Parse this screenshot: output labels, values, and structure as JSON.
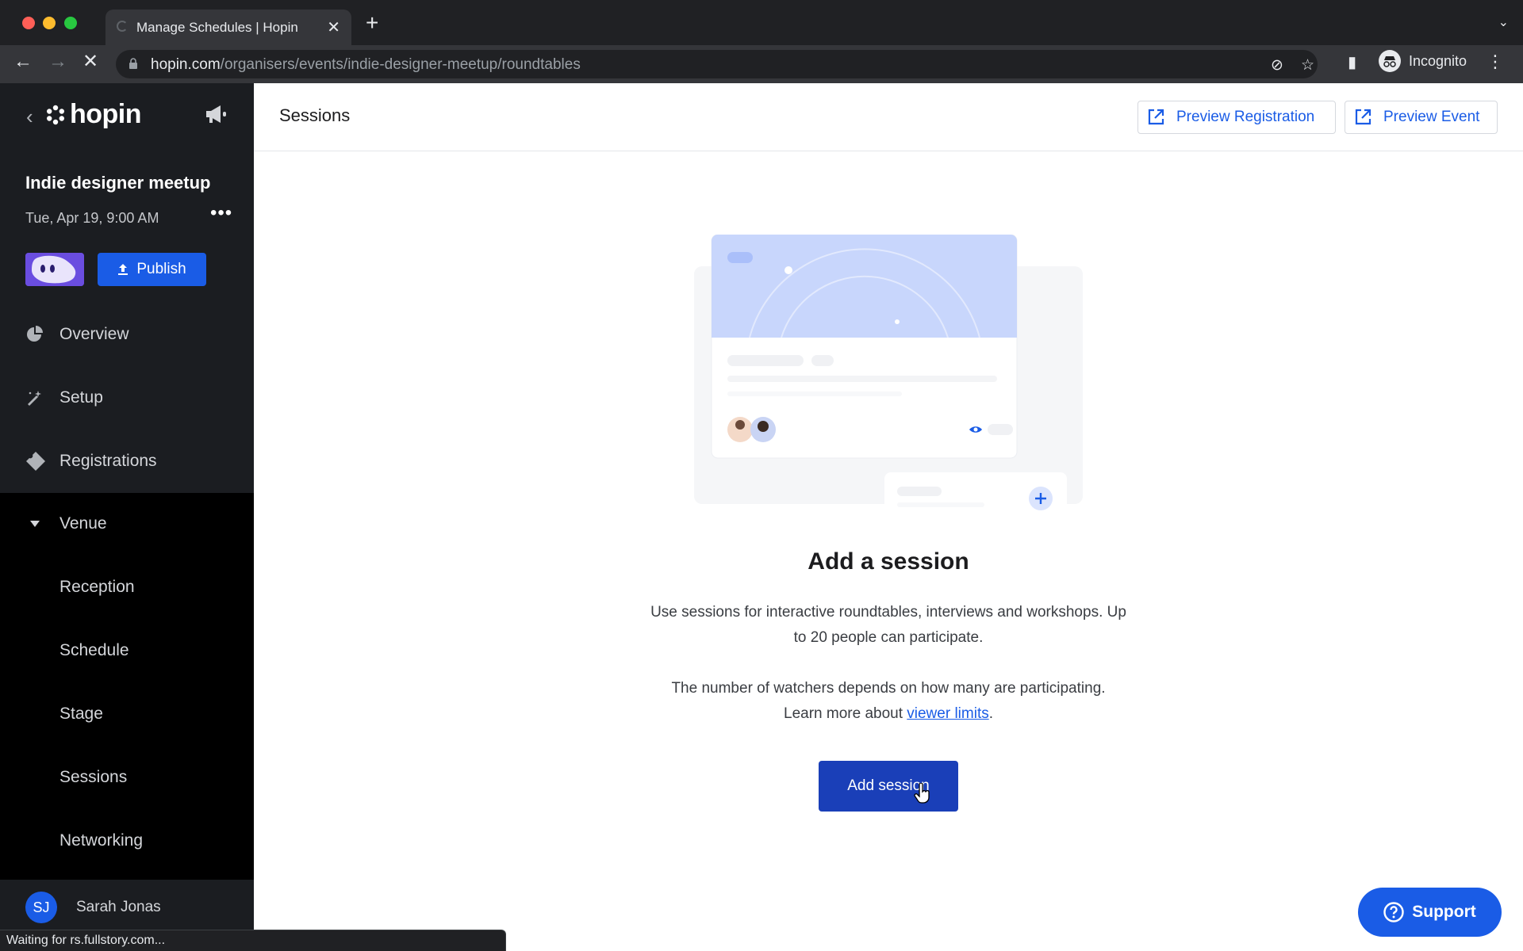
{
  "browser": {
    "tab_title": "Manage Schedules | Hopin",
    "url_host": "hopin.com",
    "url_path": "/organisers/events/indie-designer-meetup/roundtables",
    "profile_label": "Incognito",
    "status_text": "Waiting for rs.fullstory.com..."
  },
  "sidebar": {
    "logo_text": "hopin",
    "event_name": "Indie designer meetup",
    "event_date": "Tue, Apr 19, 9:00 AM",
    "publish_label": "Publish",
    "nav": [
      {
        "label": "Overview",
        "icon": "pie-chart-icon"
      },
      {
        "label": "Setup",
        "icon": "magic-wand-icon"
      },
      {
        "label": "Registrations",
        "icon": "ticket-icon"
      },
      {
        "label": "Venue",
        "icon": "caret-down-icon"
      }
    ],
    "venue_items": [
      "Reception",
      "Schedule",
      "Stage",
      "Sessions",
      "Networking"
    ],
    "user": {
      "initials": "SJ",
      "name": "Sarah Jonas"
    }
  },
  "header": {
    "title": "Sessions",
    "preview_registration": "Preview Registration",
    "preview_event": "Preview Event"
  },
  "empty_state": {
    "title": "Add a session",
    "p1": "Use sessions for interactive roundtables, interviews and workshops. Up to 20 people can participate.",
    "p2_prefix": "The number of watchers depends on how many are participating. Learn more about ",
    "p2_link": "viewer limits",
    "p2_suffix": ".",
    "button": "Add session"
  },
  "support_label": "Support",
  "colors": {
    "accent": "#1a5ce6",
    "sidebar_bg": "#1b1d21",
    "venue_bg": "#000000"
  }
}
